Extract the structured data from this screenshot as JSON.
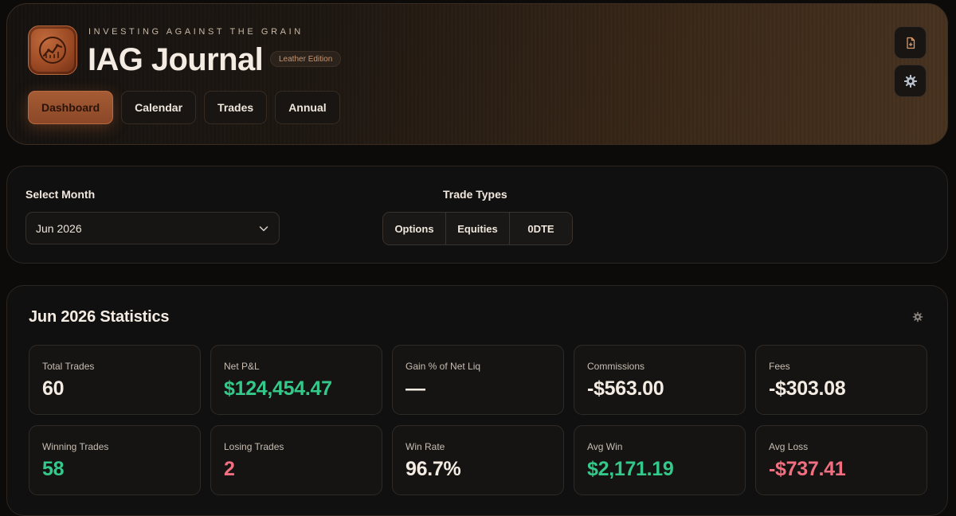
{
  "header": {
    "tagline": "INVESTING AGAINST THE GRAIN",
    "title": "IAG Journal",
    "edition_badge": "Leather Edition",
    "logo_icon": "chart-line-icon",
    "tabs": [
      {
        "label": "Dashboard",
        "active": true
      },
      {
        "label": "Calendar",
        "active": false
      },
      {
        "label": "Trades",
        "active": false
      },
      {
        "label": "Annual",
        "active": false
      }
    ],
    "actions": [
      {
        "icon": "file-plus-icon"
      },
      {
        "icon": "gear-icon"
      }
    ]
  },
  "filters": {
    "month_label": "Select Month",
    "month_value": "Jun 2026",
    "trade_types_label": "Trade Types",
    "trade_types": [
      "Options",
      "Equities",
      "0DTE"
    ]
  },
  "stats": {
    "title": "Jun 2026 Statistics",
    "cards": [
      {
        "label": "Total Trades",
        "value": "60",
        "tone": "neutral"
      },
      {
        "label": "Net P&L",
        "value": "$124,454.47",
        "tone": "positive"
      },
      {
        "label": "Gain % of Net Liq",
        "value": "—",
        "tone": "neutral"
      },
      {
        "label": "Commissions",
        "value": "-$563.00",
        "tone": "neutral"
      },
      {
        "label": "Fees",
        "value": "-$303.08",
        "tone": "neutral"
      },
      {
        "label": "Winning Trades",
        "value": "58",
        "tone": "positive"
      },
      {
        "label": "Losing Trades",
        "value": "2",
        "tone": "negative"
      },
      {
        "label": "Win Rate",
        "value": "96.7%",
        "tone": "neutral"
      },
      {
        "label": "Avg Win",
        "value": "$2,171.19",
        "tone": "positive"
      },
      {
        "label": "Avg Loss",
        "value": "-$737.41",
        "tone": "negative"
      }
    ]
  },
  "colors": {
    "accent": "#a55c35",
    "positive": "#34c98a",
    "negative": "#f16f80",
    "background": "#0c0b0a"
  }
}
